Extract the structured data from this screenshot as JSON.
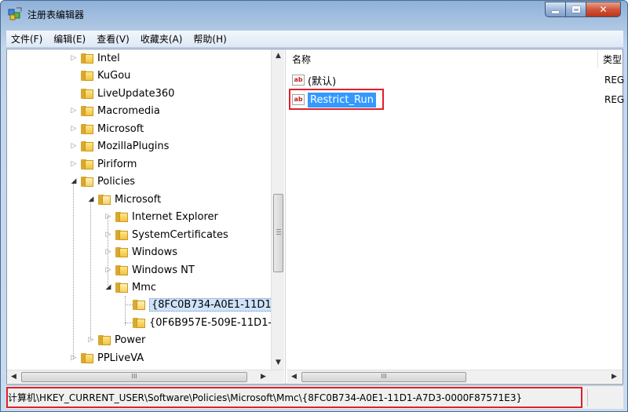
{
  "window": {
    "title": "注册表编辑器"
  },
  "menu": [
    "文件(F)",
    "编辑(E)",
    "查看(V)",
    "收藏夹(A)",
    "帮助(H)"
  ],
  "tree": {
    "nodes": [
      {
        "label": "Intel",
        "expanded": false
      },
      {
        "label": "KuGou",
        "expanded": null
      },
      {
        "label": "LiveUpdate360",
        "expanded": null
      },
      {
        "label": "Macromedia",
        "expanded": false
      },
      {
        "label": "Microsoft",
        "expanded": false
      },
      {
        "label": "MozillaPlugins",
        "expanded": false
      },
      {
        "label": "Piriform",
        "expanded": false
      },
      {
        "label": "Policies",
        "expanded": true
      },
      {
        "label": "Microsoft",
        "expanded": true
      },
      {
        "label": "Internet Explorer",
        "expanded": false
      },
      {
        "label": "SystemCertificates",
        "expanded": false
      },
      {
        "label": "Windows",
        "expanded": false
      },
      {
        "label": "Windows NT",
        "expanded": false
      },
      {
        "label": "Mmc",
        "expanded": true
      },
      {
        "label": "{8FC0B734-A0E1-11D1-",
        "expanded": null,
        "selected": true
      },
      {
        "label": "{0F6B957E-509E-11D1-/",
        "expanded": null
      },
      {
        "label": "Power",
        "expanded": false
      },
      {
        "label": "PPLiveVA",
        "expanded": false
      }
    ]
  },
  "list": {
    "columns": [
      "名称",
      "类型"
    ],
    "rows": [
      {
        "name": "(默认)",
        "type": "REG",
        "icon": "ab-string-icon"
      },
      {
        "name": "Restrict_Run",
        "type": "REG",
        "icon": "ab-string-icon",
        "selected": true
      }
    ]
  },
  "scroll": {
    "h_thumb_glyph": "III"
  },
  "statusbar": {
    "path": "计算机\\HKEY_CURRENT_USER\\Software\\Policies\\Microsoft\\Mmc\\{8FC0B734-A0E1-11D1-A7D3-0000F87571E3}"
  },
  "colors": {
    "highlight": "#e0202a",
    "selection": "#3399ff"
  }
}
